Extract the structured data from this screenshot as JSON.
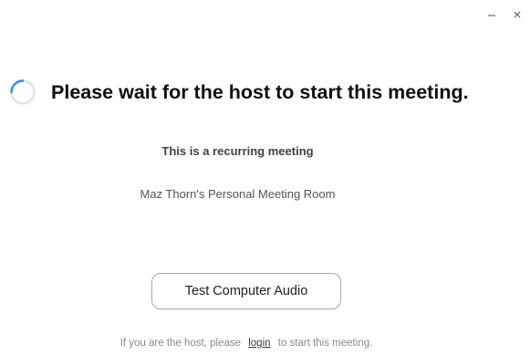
{
  "window": {
    "minimize_glyph": "–",
    "close_glyph": "×"
  },
  "header": {
    "spinner_icon": "loading-spinner-icon",
    "title": "Please wait for the host to start this meeting."
  },
  "meeting": {
    "recurring_label": "This is a recurring meeting",
    "room_name": "Maz Thorn's Personal Meeting Room"
  },
  "actions": {
    "test_audio_label": "Test Computer Audio"
  },
  "footer": {
    "prefix": "If you are the host, please",
    "login_link": "login",
    "suffix": "to start this meeting."
  },
  "colors": {
    "spinner_track": "#d8e3f0",
    "spinner_arc": "#2d8cff"
  }
}
